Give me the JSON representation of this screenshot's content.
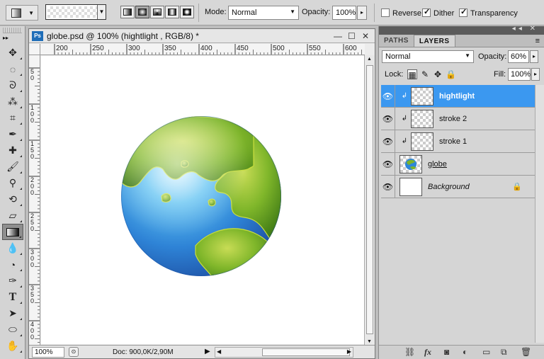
{
  "options_bar": {
    "mode_label": "Mode:",
    "mode_value": "Normal",
    "opacity_label": "Opacity:",
    "opacity_value": "100%",
    "reverse_label": "Reverse",
    "reverse_checked": false,
    "dither_label": "Dither",
    "dither_checked": true,
    "transparency_label": "Transparency",
    "transparency_checked": true,
    "gradient_types": [
      "linear-gradient-icon",
      "radial-gradient-icon",
      "angle-gradient-icon",
      "reflected-gradient-icon",
      "diamond-gradient-icon"
    ],
    "selected_gradient_type": "radial-gradient-icon"
  },
  "toolbox": {
    "tools": [
      "move-tool-icon",
      "marquee-tool-icon",
      "lasso-tool-icon",
      "magic-wand-tool-icon",
      "crop-tool-icon",
      "eyedropper-tool-icon",
      "healing-brush-tool-icon",
      "brush-tool-icon",
      "clone-stamp-tool-icon",
      "history-brush-tool-icon",
      "eraser-tool-icon",
      "gradient-tool-icon",
      "blur-tool-icon",
      "dodge-tool-icon",
      "pen-tool-icon",
      "type-tool-icon",
      "path-selection-tool-icon",
      "shape-tool-icon",
      "hand-tool-icon"
    ],
    "selected_tool": "gradient-tool-icon"
  },
  "document": {
    "title": "globe.psd @ 100% (hightlight , RGB/8) *",
    "ruler_h_labels": [
      "200",
      "250",
      "300",
      "350",
      "400",
      "450",
      "500",
      "550",
      "600"
    ],
    "ruler_v_labels": [
      "50",
      "100",
      "150",
      "200",
      "250",
      "300",
      "350",
      "400"
    ],
    "zoom": "100%",
    "doc_info": "Doc: 900,0K/2,90M"
  },
  "panels": {
    "tabs": [
      "PATHS",
      "LAYERS"
    ],
    "active_tab": "LAYERS",
    "blend_mode": "Normal",
    "opacity_label": "Opacity:",
    "opacity_value": "60%",
    "lock_label": "Lock:",
    "fill_label": "Fill:",
    "fill_value": "100%",
    "layers": [
      {
        "name": "hightlight",
        "selected": true,
        "clipped": true,
        "thumb": "transparent"
      },
      {
        "name": "stroke 2",
        "selected": false,
        "clipped": true,
        "thumb": "transparent"
      },
      {
        "name": "stroke 1",
        "selected": false,
        "clipped": true,
        "thumb": "transparent"
      },
      {
        "name": "globe",
        "selected": false,
        "clipped": false,
        "thumb": "globe"
      },
      {
        "name": "Background",
        "selected": false,
        "clipped": false,
        "thumb": "white",
        "locked": true
      }
    ],
    "bottom_icons": [
      "link-layers-icon",
      "fx-icon",
      "add-mask-icon",
      "adjustment-layer-icon",
      "new-group-icon",
      "new-layer-icon",
      "trash-icon"
    ]
  },
  "colors": {
    "selected_layer": "#3b98f0",
    "ocean_blue": "#2d86d9",
    "land_green": "#6ca81f"
  }
}
